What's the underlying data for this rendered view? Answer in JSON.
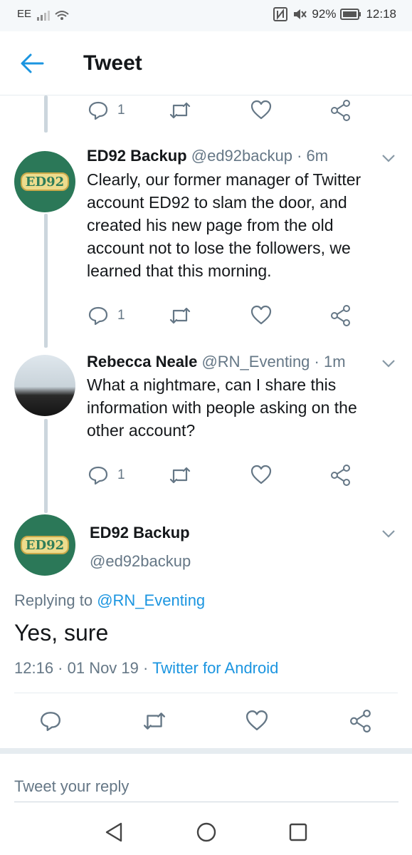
{
  "status_bar": {
    "carrier": "EE",
    "battery": "92%",
    "time": "12:18",
    "icons": [
      "signal-icon",
      "wifi-icon",
      "nfc-icon",
      "mute-icon",
      "battery-icon"
    ]
  },
  "header": {
    "title": "Tweet",
    "back_icon": "arrow-left-icon",
    "accent_color": "#1b95e0"
  },
  "top_actions": {
    "reply_count": "1"
  },
  "tweets": [
    {
      "display_name": "ED92 Backup",
      "handle": "@ed92backup",
      "time": "· 6m",
      "avatar_text": "ED92",
      "text": "Clearly, our former manager of Twitter account ED92 to slam the door, and created his new page from the old account not to lose the followers, we learned that this morning.",
      "reply_count": "1"
    },
    {
      "display_name": "Rebecca Neale",
      "handle": "@RN_Eventing",
      "time": "· 1m",
      "text": "What a nightmare, can I share this information with people asking on the other account?",
      "reply_count": "1"
    }
  ],
  "main_tweet": {
    "display_name": "ED92 Backup",
    "handle": "@ed92backup",
    "avatar_text": "ED92",
    "replying_prefix": "Replying to",
    "replying_to": "@RN_Eventing",
    "text": "Yes, sure",
    "timestamp": "12:16 · 01 Nov 19 ·",
    "source": "Twitter for Android"
  },
  "reply_input": {
    "placeholder": "Tweet your reply"
  },
  "nav_bar": {
    "icons": [
      "back-triangle-icon",
      "home-circle-icon",
      "recents-square-icon"
    ]
  }
}
